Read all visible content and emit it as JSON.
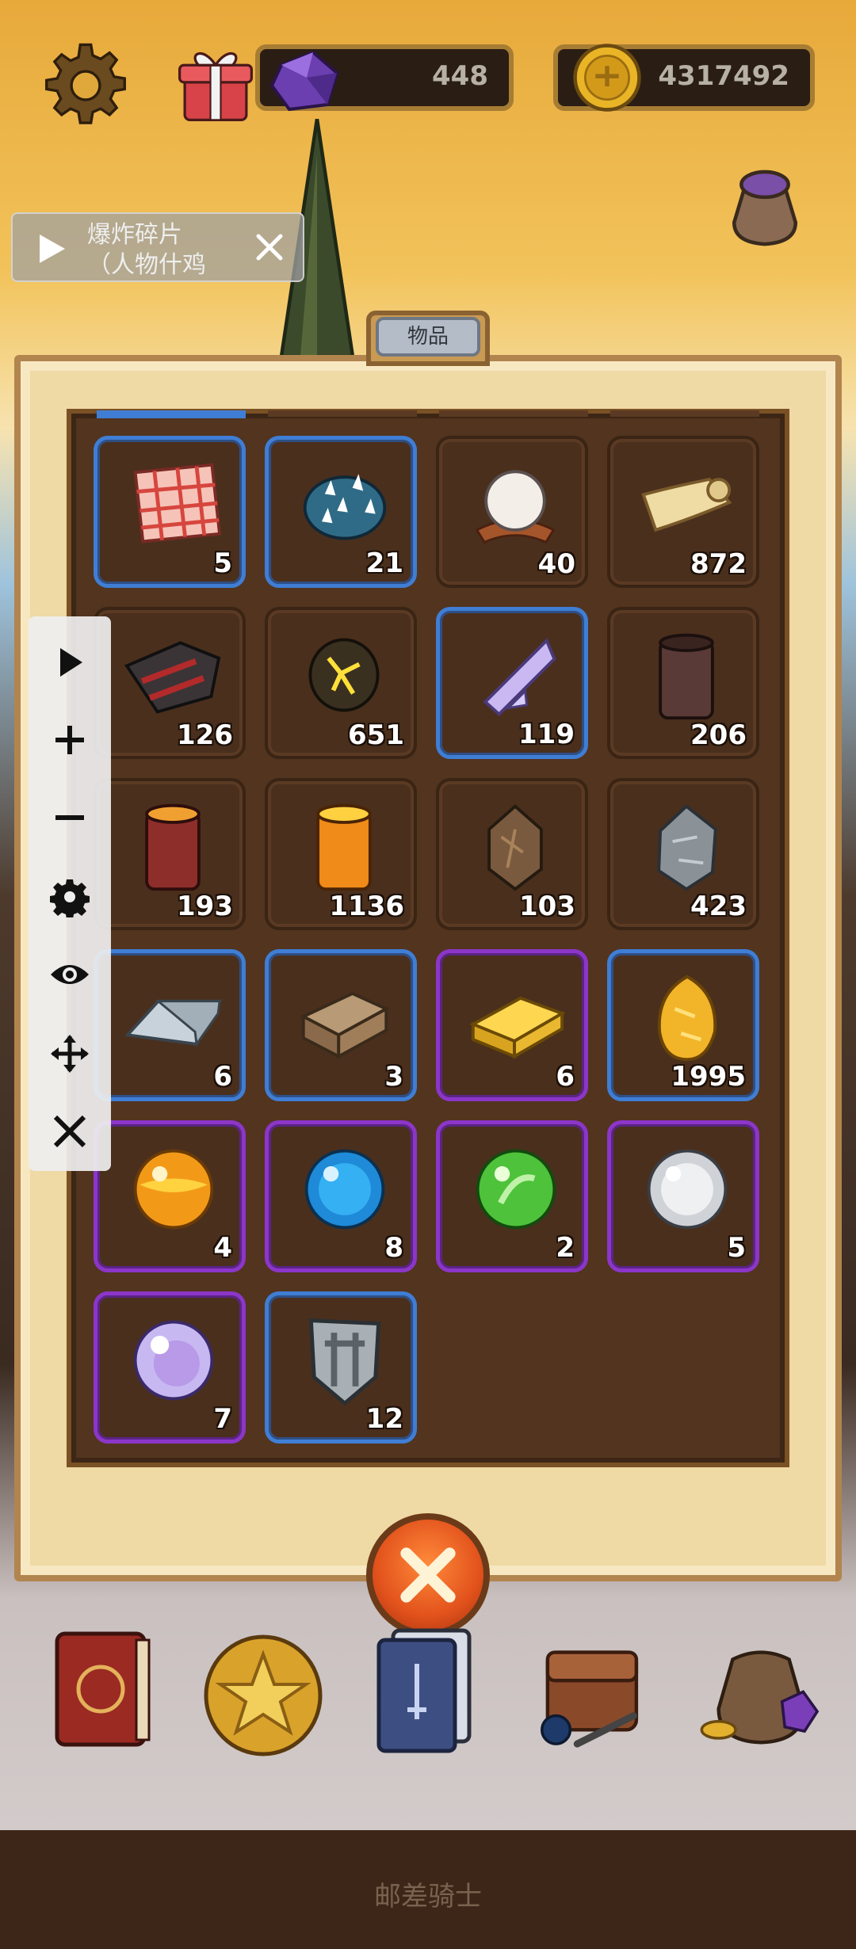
{
  "top_bar": {
    "gems": "448",
    "coins": "4317492"
  },
  "ad": {
    "line1": "爆炸碎片",
    "line2": "（人物什鸡"
  },
  "panel": {
    "tab_title": "物品"
  },
  "items": [
    {
      "icon": "checkered-cloth-icon",
      "count": "5",
      "rarity": "rare"
    },
    {
      "icon": "spiked-shell-icon",
      "count": "21",
      "rarity": "rare"
    },
    {
      "icon": "white-fur-icon",
      "count": "40",
      "rarity": "common"
    },
    {
      "icon": "parchment-scroll-icon",
      "count": "872",
      "rarity": "common"
    },
    {
      "icon": "dark-cloth-icon",
      "count": "126",
      "rarity": "common"
    },
    {
      "icon": "cracked-ore-icon",
      "count": "651",
      "rarity": "common"
    },
    {
      "icon": "crystal-shard-icon",
      "count": "119",
      "rarity": "rare"
    },
    {
      "icon": "dark-log-icon",
      "count": "206",
      "rarity": "common"
    },
    {
      "icon": "red-log-icon",
      "count": "193",
      "rarity": "common"
    },
    {
      "icon": "orange-log-icon",
      "count": "1136",
      "rarity": "common"
    },
    {
      "icon": "brown-stone-icon",
      "count": "103",
      "rarity": "common"
    },
    {
      "icon": "grey-stone-icon",
      "count": "423",
      "rarity": "common"
    },
    {
      "icon": "silver-ingot-icon",
      "count": "6",
      "rarity": "rare"
    },
    {
      "icon": "bronze-ingot-icon",
      "count": "3",
      "rarity": "rare"
    },
    {
      "icon": "gold-ingot-icon",
      "count": "6",
      "rarity": "epic"
    },
    {
      "icon": "gold-nugget-icon",
      "count": "1995",
      "rarity": "rare"
    },
    {
      "icon": "orange-orb-icon",
      "count": "4",
      "rarity": "epic"
    },
    {
      "icon": "blue-orb-icon",
      "count": "8",
      "rarity": "epic"
    },
    {
      "icon": "green-orb-icon",
      "count": "2",
      "rarity": "epic"
    },
    {
      "icon": "white-orb-icon",
      "count": "5",
      "rarity": "epic"
    },
    {
      "icon": "violet-orb-icon",
      "count": "7",
      "rarity": "epic"
    },
    {
      "icon": "shield-icon",
      "count": "12",
      "rarity": "rare"
    }
  ],
  "nav": [
    "book-icon",
    "star-coin-icon",
    "card-deck-icon",
    "backpack-icon",
    "treasure-bag-icon"
  ],
  "footer": {
    "title": "邮差骑士"
  },
  "colors": {
    "rare": "#3f7ed4",
    "epic": "#8c36c8",
    "panel": "#efd9a4",
    "inner": "#52341f"
  }
}
